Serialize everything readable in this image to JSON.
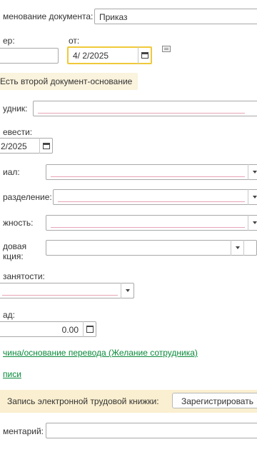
{
  "doc_name": {
    "label": "менование документа:",
    "value": "Приказ"
  },
  "number": {
    "label": "ер:",
    "value": ""
  },
  "date_from": {
    "label": "от:",
    "value": "4/ 2/2025"
  },
  "second_doc": {
    "text": "Есть второй документ-основание"
  },
  "employee": {
    "label": "удник:",
    "value": ""
  },
  "transfer": {
    "label": "евести:",
    "value": "2/2025"
  },
  "branch": {
    "label": "иал:",
    "value": ""
  },
  "department": {
    "label": "разделение:",
    "value": ""
  },
  "position": {
    "label": "жность:",
    "value": ""
  },
  "labor_function": {
    "label_line1": "довая",
    "label_line2": "кция:",
    "value": ""
  },
  "employment": {
    "label": "занятости:",
    "value": ""
  },
  "rate": {
    "label": "ад:",
    "value": "0.00"
  },
  "reason_link": {
    "text": "чина/основание перевода (Желание сотрудника)"
  },
  "signatures_link": {
    "text": "писи"
  },
  "etk": {
    "text": "Запись электронной трудовой книжки:",
    "button": "Зарегистрировать"
  },
  "comment": {
    "label": "ментарий:",
    "value": ""
  }
}
